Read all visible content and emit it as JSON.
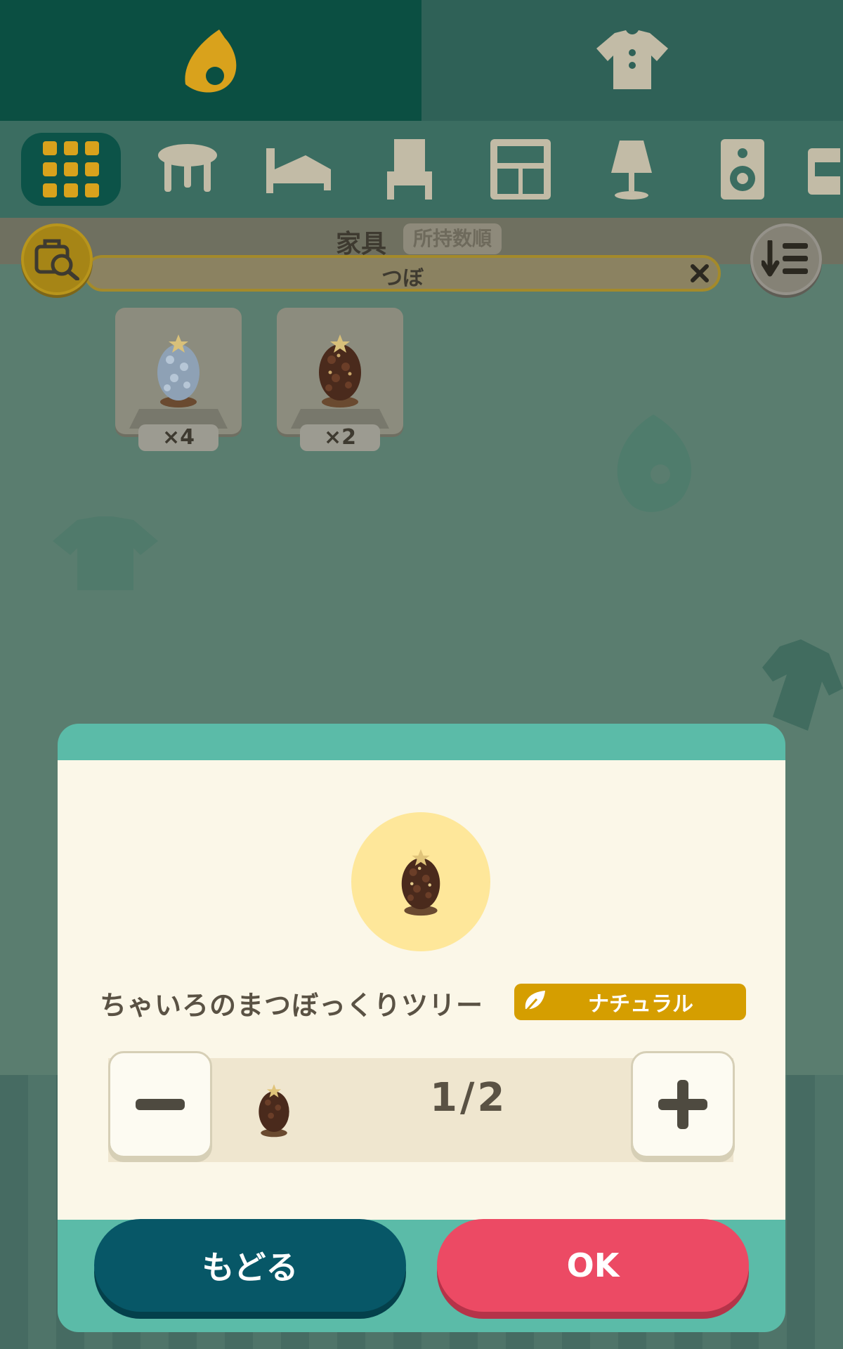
{
  "top_tabs": [
    {
      "icon": "leaf-icon",
      "active": true
    },
    {
      "icon": "shirt-icon",
      "active": false
    }
  ],
  "categories": [
    {
      "icon": "grid-icon",
      "active": true
    },
    {
      "icon": "table-icon"
    },
    {
      "icon": "bed-icon"
    },
    {
      "icon": "chair-icon"
    },
    {
      "icon": "bookshelf-icon"
    },
    {
      "icon": "lamp-icon"
    },
    {
      "icon": "speaker-icon"
    },
    {
      "icon": "counter-icon"
    }
  ],
  "header": {
    "title": "家具",
    "sort_label": "所持数順"
  },
  "search": {
    "value": "つぼ"
  },
  "items": [
    {
      "count": "4",
      "color": "blue"
    },
    {
      "count": "2",
      "color": "brown"
    }
  ],
  "dialog": {
    "item_name": "ちゃいろのまつぼっくりツリー",
    "theme": "ナチュラル",
    "quantity": "1/2",
    "back_label": "もどる",
    "ok_label": "OK"
  },
  "colors": {
    "accent_gold": "#d59e00",
    "ok_red": "#ec4a64",
    "back_teal": "#075767",
    "dialog_frame": "#5bbba8"
  }
}
